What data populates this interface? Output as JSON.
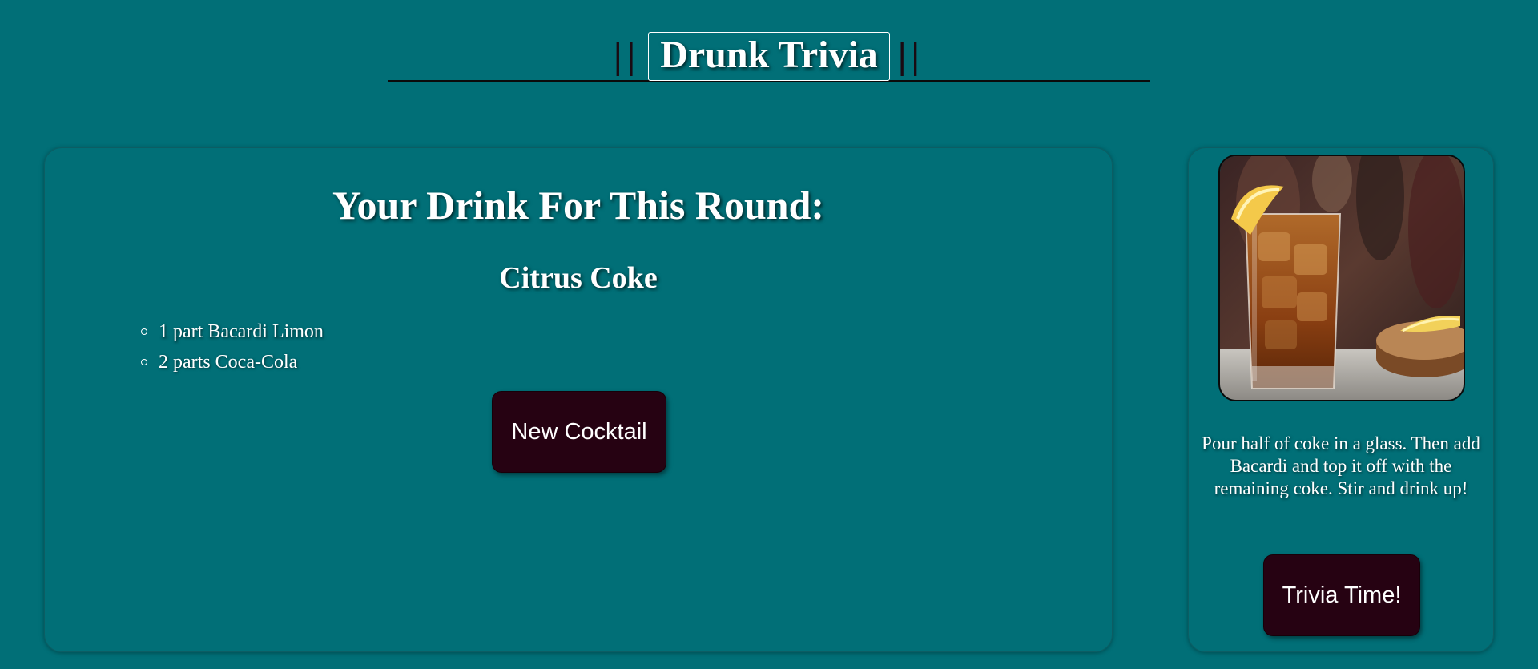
{
  "header": {
    "title": "Drunk Trivia",
    "left_bars": "||",
    "right_bars": "||"
  },
  "main": {
    "heading": "Your Drink For This Round:",
    "drink_name": "Citrus Coke",
    "ingredients": [
      "1 part Bacardi Limon",
      "2 parts Coca-Cola"
    ],
    "new_cocktail_label": "New Cocktail"
  },
  "side": {
    "image_alt": "Citrus Coke cocktail",
    "instructions": "Pour half of coke in a glass. Then add Bacardi and top it off with the remaining coke. Stir and drink up!",
    "trivia_label": "Trivia Time!"
  },
  "colors": {
    "background": "#016f77",
    "button": "#260212",
    "text": "#ffffff",
    "rule": "#0b0b0b"
  }
}
